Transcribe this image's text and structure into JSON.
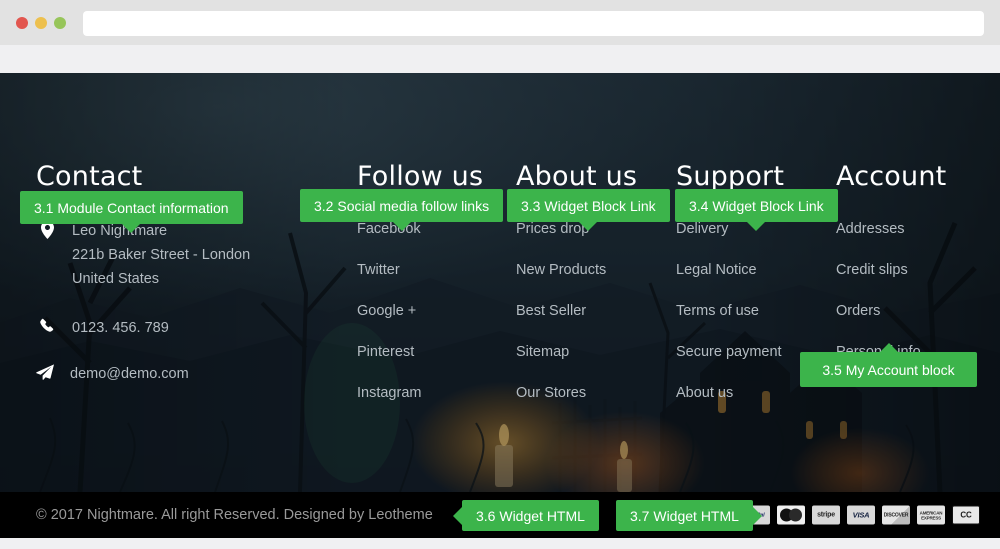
{
  "browser": {
    "traffic_lights": [
      "close-red",
      "minimize-yellow",
      "maximize-green"
    ],
    "url_value": "",
    "url_placeholder": ""
  },
  "colors": {
    "accent_green": "#3cb44b",
    "footer_bg_dark": "#1c2630",
    "bottom_bar": "#000000",
    "link_text": "#b4bcc2",
    "heading_text": "#ffffff"
  },
  "annotations": [
    {
      "id": "3.1",
      "label": "3.1 Module Contact information",
      "pointer": "down"
    },
    {
      "id": "3.2",
      "label": "3.2 Social media follow links",
      "pointer": "down"
    },
    {
      "id": "3.3",
      "label": "3.3 Widget Block Link",
      "pointer": "down"
    },
    {
      "id": "3.4",
      "label": "3.4 Widget Block Link",
      "pointer": "down"
    },
    {
      "id": "3.5",
      "label": "3.5 My Account block",
      "pointer": "up"
    },
    {
      "id": "3.6",
      "label": "3.6 Widget HTML",
      "pointer": "left"
    },
    {
      "id": "3.7",
      "label": "3.7 Widget HTML",
      "pointer": "right"
    }
  ],
  "footer": {
    "contact": {
      "heading": "Contact",
      "address_icon": "map-pin-icon",
      "address_lines": [
        "Leo Nightmare",
        "221b Baker Street - London",
        "United States"
      ],
      "phone_icon": "phone-icon",
      "phone": "0123. 456. 789",
      "email_icon": "paper-plane-icon",
      "email": "demo@demo.com"
    },
    "follow": {
      "heading": "Follow us",
      "links": [
        "Facebook",
        "Twitter",
        "Google +",
        "Pinterest",
        "Instagram"
      ]
    },
    "about": {
      "heading": "About us",
      "links": [
        "Prices drop",
        "New Products",
        "Best Seller",
        "Sitemap",
        "Our Stores"
      ]
    },
    "support": {
      "heading": "Support",
      "links": [
        "Delivery",
        "Legal Notice",
        "Terms of use",
        "Secure payment",
        "About us"
      ]
    },
    "account": {
      "heading": "Account",
      "links": [
        "Addresses",
        "Credit slips",
        "Orders",
        "Personal info"
      ]
    }
  },
  "bottom": {
    "copyright": "© 2017 Nightmare. All right Reserved. Designed by Leotheme",
    "payments": [
      {
        "name": "paypal-icon",
        "label": "PayPal"
      },
      {
        "name": "mastercard-icon",
        "label": ""
      },
      {
        "name": "stripe-icon",
        "label": "stripe"
      },
      {
        "name": "visa-icon",
        "label": "VISA"
      },
      {
        "name": "discover-icon",
        "label": "DISCOVER"
      },
      {
        "name": "amex-icon",
        "label": "AMERICAN EXPRESS"
      },
      {
        "name": "cc-icon",
        "label": "CC"
      }
    ]
  }
}
